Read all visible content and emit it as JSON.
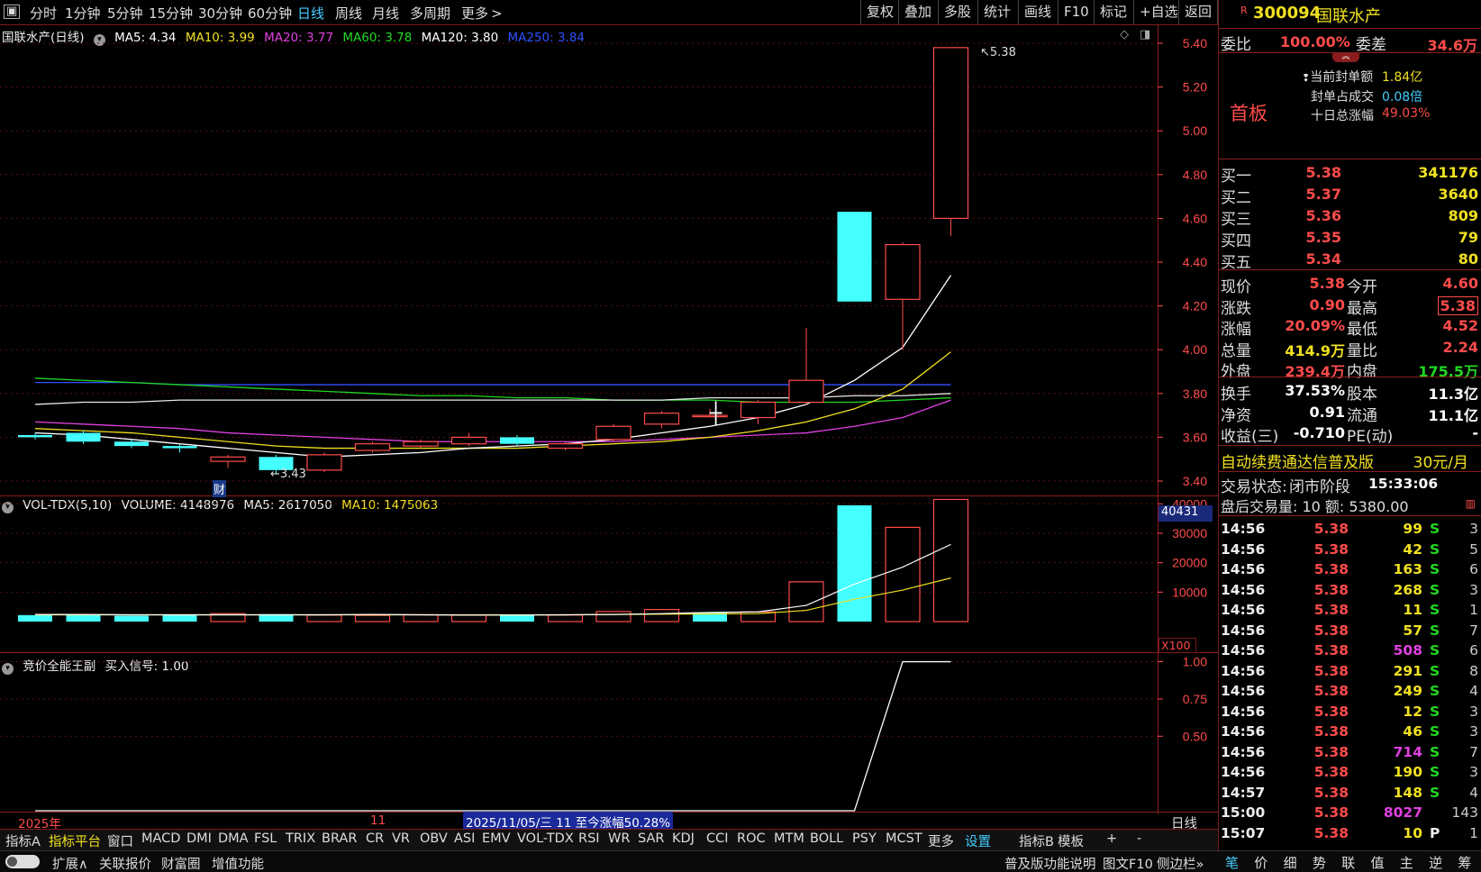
{
  "toolbar": {
    "menu_icon": "menu-icon",
    "tabs": [
      "分时",
      "1分钟",
      "5分钟",
      "15分钟",
      "30分钟",
      "60分钟",
      "日线",
      "周线",
      "月线",
      "多周期",
      "更多"
    ],
    "active_tab": "日线",
    "more_arrow": ">",
    "right_buttons": [
      "复权",
      "叠加",
      "多股",
      "统计",
      "画线",
      "F10",
      "标记",
      "+自选",
      "返回"
    ]
  },
  "kline": {
    "title": "国联水产(日线)",
    "ma": [
      {
        "label": "MA5: 4.34",
        "color": "#ffffff"
      },
      {
        "label": "MA10: 3.99",
        "color": "#f0e020"
      },
      {
        "label": "MA20: 3.77",
        "color": "#e040e0"
      },
      {
        "label": "MA60: 3.78",
        "color": "#22d822"
      },
      {
        "label": "MA120: 3.80",
        "color": "#ffffff"
      },
      {
        "label": "MA250: 3.84",
        "color": "#3050ff"
      }
    ],
    "y_ticks": [
      "5.40",
      "5.20",
      "5.00",
      "4.80",
      "4.60",
      "4.40",
      "4.20",
      "4.00",
      "3.80",
      "3.60",
      "3.40"
    ],
    "high_label": "5.38",
    "low_label": "3.43",
    "fin_marker": "财"
  },
  "volume": {
    "title": "VOL-TDX(5,10)",
    "volume_label": "VOLUME: 4148976",
    "ma5_label": "MA5: 2617050",
    "ma10_label": "MA10: 1475063",
    "highlight_value": "40431",
    "y_ticks": [
      "40000",
      "30000",
      "20000",
      "10000"
    ],
    "unit": "X100"
  },
  "signal": {
    "title": "竞价全能王副",
    "signal_label": "买入信号: 1.00",
    "y_ticks": [
      "1.00",
      "0.75",
      "0.50"
    ]
  },
  "date_axis": {
    "year_label": "2025年",
    "month_label": "11",
    "range_label": "2025/11/05/三 11 至今涨幅50.28%",
    "period_label": "日线"
  },
  "chart_data": [
    {
      "type": "candlestick",
      "title": "国联水产(日线)",
      "ylim": [
        3.4,
        5.4
      ],
      "candles": [
        {
          "o": 3.6,
          "h": 3.62,
          "l": 3.59,
          "c": 3.61,
          "up": false
        },
        {
          "o": 3.62,
          "h": 3.63,
          "l": 3.57,
          "c": 3.58,
          "up": false
        },
        {
          "o": 3.58,
          "h": 3.59,
          "l": 3.55,
          "c": 3.56,
          "up": false
        },
        {
          "o": 3.56,
          "h": 3.57,
          "l": 3.53,
          "c": 3.55,
          "up": false
        },
        {
          "o": 3.49,
          "h": 3.52,
          "l": 3.46,
          "c": 3.51,
          "up": true
        },
        {
          "o": 3.51,
          "h": 3.52,
          "l": 3.43,
          "c": 3.45,
          "up": false
        },
        {
          "o": 3.45,
          "h": 3.53,
          "l": 3.44,
          "c": 3.52,
          "up": true
        },
        {
          "o": 3.54,
          "h": 3.58,
          "l": 3.53,
          "c": 3.57,
          "up": true
        },
        {
          "o": 3.56,
          "h": 3.59,
          "l": 3.55,
          "c": 3.58,
          "up": true
        },
        {
          "o": 3.57,
          "h": 3.62,
          "l": 3.56,
          "c": 3.6,
          "up": true
        },
        {
          "o": 3.6,
          "h": 3.61,
          "l": 3.56,
          "c": 3.57,
          "up": false
        },
        {
          "o": 3.55,
          "h": 3.58,
          "l": 3.54,
          "c": 3.57,
          "up": true
        },
        {
          "o": 3.59,
          "h": 3.66,
          "l": 3.58,
          "c": 3.65,
          "up": true
        },
        {
          "o": 3.66,
          "h": 3.72,
          "l": 3.64,
          "c": 3.71,
          "up": true
        },
        {
          "o": 3.7,
          "h": 3.73,
          "l": 3.69,
          "c": 3.7,
          "up": true
        },
        {
          "o": 3.69,
          "h": 3.77,
          "l": 3.66,
          "c": 3.76,
          "up": true
        },
        {
          "o": 3.76,
          "h": 4.1,
          "l": 3.75,
          "c": 3.86,
          "up": true
        },
        {
          "o": 4.63,
          "h": 4.63,
          "l": 4.22,
          "c": 4.22,
          "up": false
        },
        {
          "o": 4.23,
          "h": 4.49,
          "l": 4.0,
          "c": 4.48,
          "up": true
        },
        {
          "o": 4.6,
          "h": 5.38,
          "l": 4.52,
          "c": 5.38,
          "up": true
        }
      ],
      "ma5": [
        3.62,
        3.61,
        3.59,
        3.57,
        3.55,
        3.53,
        3.51,
        3.52,
        3.53,
        3.55,
        3.56,
        3.57,
        3.59,
        3.62,
        3.65,
        3.69,
        3.75,
        3.86,
        4.01,
        4.34
      ],
      "ma10": [
        3.64,
        3.63,
        3.62,
        3.6,
        3.58,
        3.56,
        3.55,
        3.55,
        3.55,
        3.55,
        3.55,
        3.56,
        3.57,
        3.58,
        3.6,
        3.63,
        3.67,
        3.73,
        3.82,
        3.99
      ],
      "ma20": [
        3.67,
        3.66,
        3.65,
        3.64,
        3.62,
        3.61,
        3.6,
        3.59,
        3.58,
        3.58,
        3.58,
        3.58,
        3.58,
        3.59,
        3.6,
        3.61,
        3.62,
        3.65,
        3.69,
        3.77
      ],
      "ma60": [
        3.87,
        3.86,
        3.85,
        3.84,
        3.83,
        3.82,
        3.81,
        3.8,
        3.79,
        3.79,
        3.78,
        3.78,
        3.77,
        3.77,
        3.77,
        3.76,
        3.76,
        3.76,
        3.77,
        3.78
      ],
      "ma120": [
        3.75,
        3.76,
        3.76,
        3.77,
        3.77,
        3.77,
        3.77,
        3.77,
        3.77,
        3.77,
        3.77,
        3.77,
        3.77,
        3.77,
        3.78,
        3.78,
        3.78,
        3.79,
        3.79,
        3.8
      ],
      "ma250": [
        3.85,
        3.85,
        3.85,
        3.84,
        3.84,
        3.84,
        3.84,
        3.84,
        3.84,
        3.84,
        3.84,
        3.84,
        3.84,
        3.84,
        3.84,
        3.84,
        3.84,
        3.84,
        3.84,
        3.84
      ]
    },
    {
      "type": "bar",
      "title": "VOL-TDX(5,10)",
      "ylim": [
        0,
        41000
      ],
      "values": [
        2200,
        2400,
        2000,
        2200,
        2700,
        2500,
        2200,
        2100,
        2300,
        2200,
        2400,
        2200,
        3400,
        4100,
        3100,
        3300,
        13500,
        39500,
        32000,
        41480
      ],
      "up": [
        false,
        false,
        false,
        false,
        true,
        false,
        true,
        true,
        true,
        true,
        false,
        true,
        true,
        true,
        false,
        true,
        true,
        false,
        true,
        true
      ],
      "ma5": [
        2400,
        2400,
        2300,
        2300,
        2300,
        2300,
        2300,
        2400,
        2300,
        2200,
        2200,
        2300,
        2400,
        2700,
        3100,
        3300,
        5500,
        12700,
        18500,
        26200
      ],
      "ma10": [
        2300,
        2300,
        2300,
        2300,
        2300,
        2300,
        2300,
        2300,
        2300,
        2300,
        2300,
        2300,
        2400,
        2500,
        2600,
        2700,
        3800,
        7600,
        10700,
        14800
      ]
    },
    {
      "type": "line",
      "title": "竞价全能王副",
      "ylim": [
        0,
        1.1
      ],
      "series": [
        {
          "name": "买入信号",
          "values": [
            0,
            0,
            0,
            0,
            0,
            0,
            0,
            0,
            0,
            0,
            0,
            0,
            0,
            0,
            0,
            0,
            0,
            0,
            1,
            1
          ]
        }
      ]
    }
  ],
  "quote": {
    "badge": "R",
    "code": "300094",
    "name": "国联水产",
    "weibi_label": "委比",
    "weibi": "100.00%",
    "weicha_label": "委差",
    "weicha": "34.6万",
    "first_board": "首板",
    "seal_amount_label": "当前封单额",
    "seal_amount": "1.84亿",
    "seal_ratio_label": "封单占成交",
    "seal_ratio": "0.08倍",
    "ten_day_label": "十日总涨幅",
    "ten_day": "49.03%",
    "bids": [
      {
        "label": "买一",
        "price": "5.38",
        "vol": "341176"
      },
      {
        "label": "买二",
        "price": "5.37",
        "vol": "3640"
      },
      {
        "label": "买三",
        "price": "5.36",
        "vol": "809"
      },
      {
        "label": "买四",
        "price": "5.35",
        "vol": "79"
      },
      {
        "label": "买五",
        "price": "5.34",
        "vol": "80"
      }
    ],
    "stats": [
      {
        "l1": "现价",
        "v1": "5.38",
        "c1": "#ff4b4b",
        "l2": "今开",
        "v2": "4.60",
        "c2": "#ff4b4b"
      },
      {
        "l1": "涨跌",
        "v1": "0.90",
        "c1": "#ff4b4b",
        "l2": "最高",
        "v2": "5.38",
        "c2": "#ff4b4b"
      },
      {
        "l1": "涨幅",
        "v1": "20.09%",
        "c1": "#ff4b4b",
        "l2": "最低",
        "v2": "4.52",
        "c2": "#ff4b4b"
      },
      {
        "l1": "总量",
        "v1": "414.9万",
        "c1": "#f0e020",
        "l2": "量比",
        "v2": "2.24",
        "c2": "#ff4b4b"
      },
      {
        "l1": "外盘",
        "v1": "239.4万",
        "c1": "#ff4b4b",
        "l2": "内盘",
        "v2": "175.5万",
        "c2": "#22d822"
      }
    ],
    "stats2": [
      {
        "l1": "换手",
        "v1": "37.53%",
        "l2": "股本",
        "v2": "11.3亿"
      },
      {
        "l1": "净资",
        "v1": "0.91",
        "l2": "流通",
        "v2": "11.1亿"
      },
      {
        "l1": "收益(三)",
        "v1": "-0.710",
        "l2": "PE(动)",
        "v2": "-"
      }
    ],
    "promo": "自动续费通达信普及版",
    "promo_price": "30元/月",
    "trade_state_label": "交易状态:",
    "trade_state": "闭市阶段",
    "trade_time": "15:33:06",
    "after_hours": "盘后交易量: 10  额: 5380.00"
  },
  "ticks": [
    {
      "t": "14:56",
      "p": "5.38",
      "v": "99",
      "s": "S",
      "n": "3"
    },
    {
      "t": "14:56",
      "p": "5.38",
      "v": "42",
      "s": "S",
      "n": "5"
    },
    {
      "t": "14:56",
      "p": "5.38",
      "v": "163",
      "s": "S",
      "n": "6"
    },
    {
      "t": "14:56",
      "p": "5.38",
      "v": "268",
      "s": "S",
      "n": "3"
    },
    {
      "t": "14:56",
      "p": "5.38",
      "v": "11",
      "s": "S",
      "n": "1"
    },
    {
      "t": "14:56",
      "p": "5.38",
      "v": "57",
      "s": "S",
      "n": "7"
    },
    {
      "t": "14:56",
      "p": "5.38",
      "v": "508",
      "s": "S",
      "n": "6",
      "vc": "#e040e0"
    },
    {
      "t": "14:56",
      "p": "5.38",
      "v": "291",
      "s": "S",
      "n": "8"
    },
    {
      "t": "14:56",
      "p": "5.38",
      "v": "249",
      "s": "S",
      "n": "4"
    },
    {
      "t": "14:56",
      "p": "5.38",
      "v": "12",
      "s": "S",
      "n": "3"
    },
    {
      "t": "14:56",
      "p": "5.38",
      "v": "46",
      "s": "S",
      "n": "3"
    },
    {
      "t": "14:56",
      "p": "5.38",
      "v": "714",
      "s": "S",
      "n": "7",
      "vc": "#e040e0"
    },
    {
      "t": "14:56",
      "p": "5.38",
      "v": "190",
      "s": "S",
      "n": "3"
    },
    {
      "t": "14:57",
      "p": "5.38",
      "v": "148",
      "s": "S",
      "n": "4"
    },
    {
      "t": "15:00",
      "p": "5.38",
      "v": "8027",
      "s": "",
      "n": "143",
      "vc": "#e040e0"
    },
    {
      "t": "15:07",
      "p": "5.38",
      "v": "10",
      "s": "P",
      "n": "1"
    }
  ],
  "indicator_bar": [
    "指标A",
    "指标平台",
    "窗口",
    "MACD",
    "DMI",
    "DMA",
    "FSL",
    "TRIX",
    "BRAR",
    "CR",
    "VR",
    "OBV",
    "ASI",
    "EMV",
    "VOL-TDX",
    "RSI",
    "WR",
    "SAR",
    "KDJ",
    "CCI",
    "ROC",
    "MTM",
    "BOLL",
    "PSY",
    "MCST",
    "更多",
    "设置",
    "指标B",
    "模板",
    "+",
    "-"
  ],
  "status_bar": {
    "expand": "扩展∧",
    "related": "关联报价",
    "caifu": "财富圈",
    "value_add": "增值功能",
    "help": "普及版功能说明",
    "f10": "图文F10",
    "sidebar": "侧边栏»"
  },
  "right_tabs": [
    "笔",
    "价",
    "细",
    "势",
    "联",
    "值",
    "主",
    "逆",
    "筹"
  ]
}
